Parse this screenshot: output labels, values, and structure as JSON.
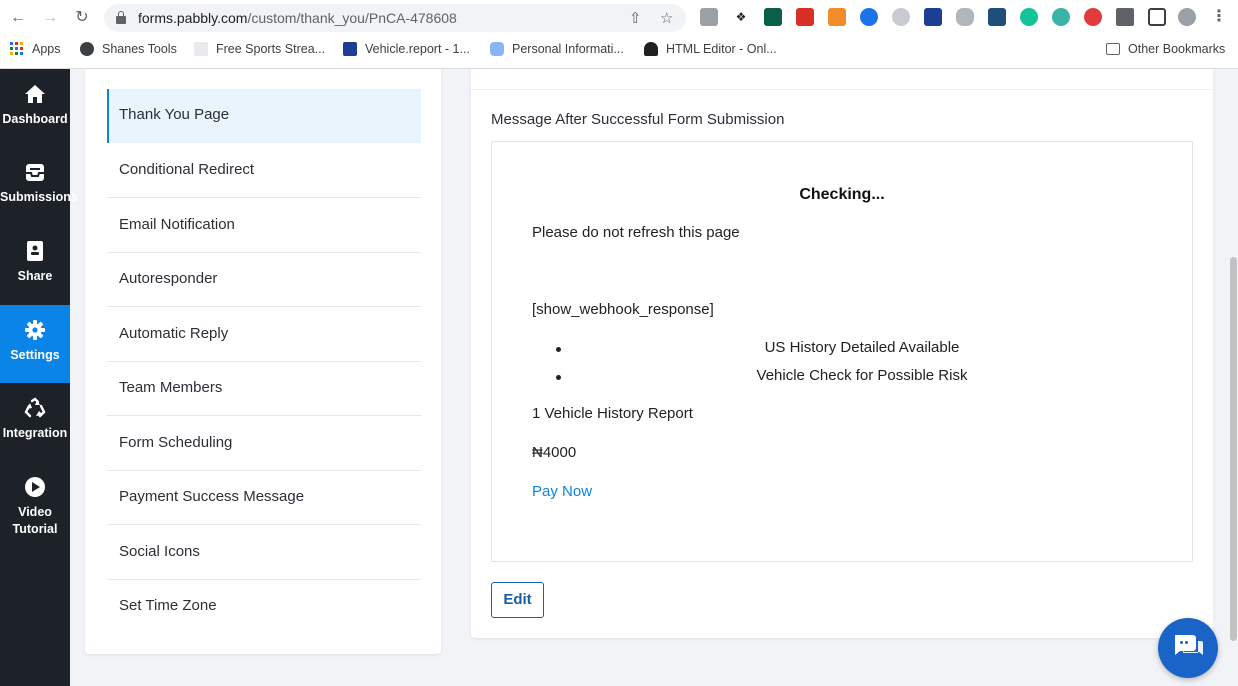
{
  "browser": {
    "url_host": "forms.pabbly.com",
    "url_path": "/custom/thank_you/PnCA-478608",
    "bookmarks": [
      {
        "label": "Apps"
      },
      {
        "label": "Shanes Tools"
      },
      {
        "label": "Free Sports Strea..."
      },
      {
        "label": "Vehicle.report - 1..."
      },
      {
        "label": "Personal Informati..."
      },
      {
        "label": "HTML Editor - Onl..."
      },
      {
        "label": "Other Bookmarks"
      }
    ]
  },
  "rail": {
    "items": [
      {
        "label": "Dashboard",
        "icon": "home-icon"
      },
      {
        "label": "Submissions",
        "icon": "inbox-icon"
      },
      {
        "label": "Share",
        "icon": "share-icon"
      },
      {
        "label": "Settings",
        "icon": "gear-icon",
        "active": true
      },
      {
        "label": "Integration",
        "icon": "recycle-icon"
      },
      {
        "label": "Video",
        "label2": "Tutorial",
        "icon": "play-icon"
      }
    ]
  },
  "menu": {
    "items": [
      {
        "label": "Thank You Page",
        "active": true
      },
      {
        "label": "Conditional Redirect"
      },
      {
        "label": "Email Notification"
      },
      {
        "label": "Autoresponder"
      },
      {
        "label": "Automatic Reply"
      },
      {
        "label": "Team Members"
      },
      {
        "label": "Form Scheduling"
      },
      {
        "label": "Payment Success Message"
      },
      {
        "label": "Social Icons"
      },
      {
        "label": "Set Time Zone"
      }
    ]
  },
  "main": {
    "section_title": "Message After Successful Form Submission",
    "preview": {
      "heading": "Checking...",
      "line1": "Please do not refresh this page",
      "shortcode": "[show_webhook_response]",
      "bullets": [
        "US History Detailed Available",
        "Vehicle Check for Possible Risk"
      ],
      "report": "1 Vehicle History Report",
      "price": "₦4000",
      "pay_label": "Pay Now"
    },
    "edit_label": "Edit"
  },
  "colors": {
    "accent": "#0a84e6",
    "rail_bg": "#1d2128",
    "chat": "#1a64c8"
  }
}
